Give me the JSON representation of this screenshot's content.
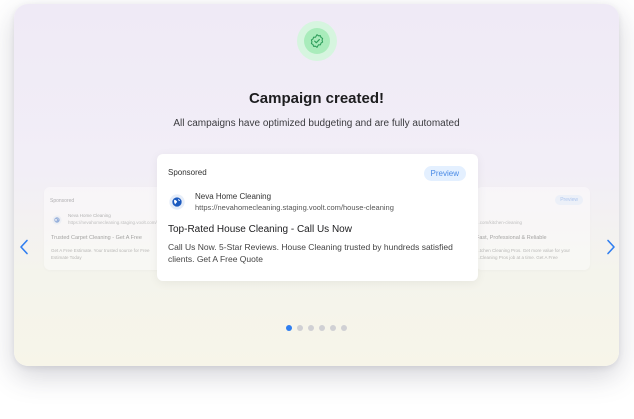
{
  "header": {
    "title": "Campaign created!",
    "subtitle": "All campaigns have optimized budgeting and are fully automated"
  },
  "carousel": {
    "main_ad": {
      "sponsored": "Sponsored",
      "preview": "Preview",
      "business": "Neva Home Cleaning",
      "url": "https://nevahomecleaning.staging.voolt.com/house-cleaning",
      "headline": "Top-Rated House Cleaning - Call Us Now",
      "description": "Call Us Now. 5-Star Reviews. House Cleaning trusted by hundreds satisfied clients. Get A Free Quote"
    },
    "left_ad": {
      "sponsored": "Sponsored",
      "business": "Neva Home Cleaning",
      "url": "https://nevahomecleaning.staging.voolt.com/",
      "headline": "Trusted Carpet Cleaning - Get A Free",
      "description": "Get A Free Estimate. Your trusted source for Free Estimate Today"
    },
    "right_ad": {
      "preview": "Preview",
      "url": "...com/kitchen-cleaning",
      "headline": "Fast, Professional & Reliable",
      "description": "...tchen Cleaning Pros. Get more value for your ...Cleaning Pros job at a time. Get A Free"
    },
    "pagination": {
      "total": 6,
      "active": 0
    }
  },
  "colors": {
    "accent": "#2f7ef0",
    "success_bg": "#d6f5df",
    "success_icon": "#2e9e5b"
  }
}
